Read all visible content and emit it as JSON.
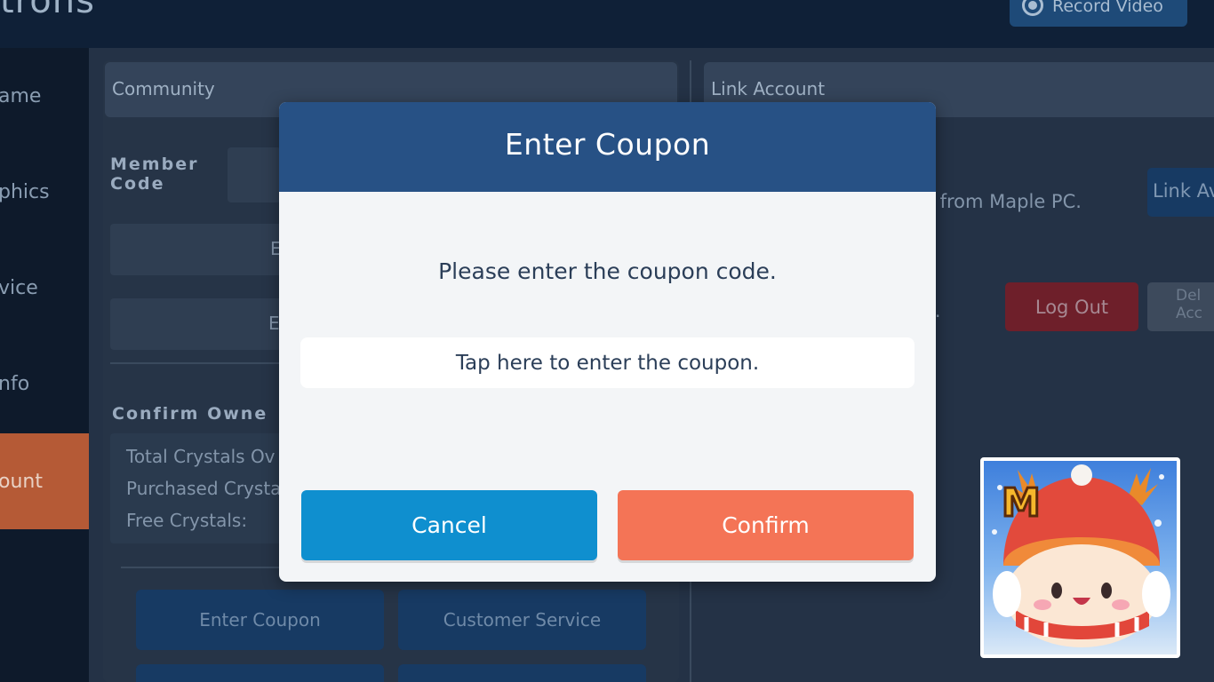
{
  "header": {
    "title": "trons",
    "record_button": "Record Video"
  },
  "sidebar": {
    "items": [
      {
        "label": "ame"
      },
      {
        "label": "phics"
      },
      {
        "label": "vice"
      },
      {
        "label": "nfo"
      },
      {
        "label": "ount",
        "active": true
      }
    ]
  },
  "community": {
    "title": "Community",
    "member_code_label": "Member Code",
    "row1_partial": "E",
    "row2_partial": "E",
    "confirm_owned": "Confirm Owne",
    "crystals": {
      "total": "Total Crystals Ov",
      "purchased": "Purchased Crysta",
      "free": "Free Crystals:"
    },
    "buttons": {
      "enter_coupon": "Enter Coupon",
      "customer_service": "Customer Service"
    }
  },
  "link_account": {
    "title": "Link Account",
    "desc_partial": "s from Maple PC.",
    "link_button": "Link Av",
    "dot": ".",
    "log_out": "Log Out",
    "delete_partial": "Del Acc"
  },
  "dialog": {
    "title": "Enter Coupon",
    "message": "Please enter the coupon code.",
    "input_placeholder": "Tap here to enter the coupon.",
    "input_value": "",
    "cancel_label": "Cancel",
    "confirm_label": "Confirm",
    "colors": {
      "header": "#275185",
      "cancel": "#0f8fcf",
      "confirm": "#f47456"
    }
  },
  "app_badge": {
    "icon": "maplestory-m-app-icon",
    "letter": "M"
  }
}
